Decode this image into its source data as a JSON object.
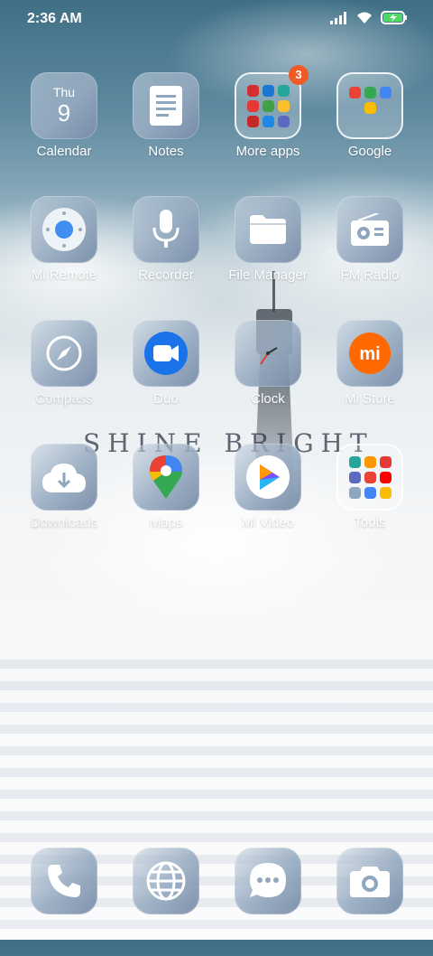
{
  "status_bar": {
    "time": "2:36 AM"
  },
  "wallpaper": {
    "motto": "SHINE BRIGHT"
  },
  "apps": [
    {
      "label": "Calendar",
      "day": "Thu",
      "date": "9"
    },
    {
      "label": "Notes"
    },
    {
      "label": "More apps",
      "badge": "3"
    },
    {
      "label": "Google"
    },
    {
      "label": "Mi Remote"
    },
    {
      "label": "Recorder"
    },
    {
      "label": "File Manager"
    },
    {
      "label": "FM Radio"
    },
    {
      "label": "Compass"
    },
    {
      "label": "Duo"
    },
    {
      "label": "Clock"
    },
    {
      "label": "Mi Store"
    },
    {
      "label": "Downloads"
    },
    {
      "label": "Maps"
    },
    {
      "label": "Mi Video"
    },
    {
      "label": "Tools"
    }
  ],
  "dock": [
    {
      "name": "Phone"
    },
    {
      "name": "Browser"
    },
    {
      "name": "Messaging"
    },
    {
      "name": "Camera"
    }
  ],
  "colors": {
    "tile_accent": "#8fa6bf",
    "badge": "#f05a24",
    "duo_blue": "#1a73e8",
    "mi_orange": "#ff6900"
  }
}
